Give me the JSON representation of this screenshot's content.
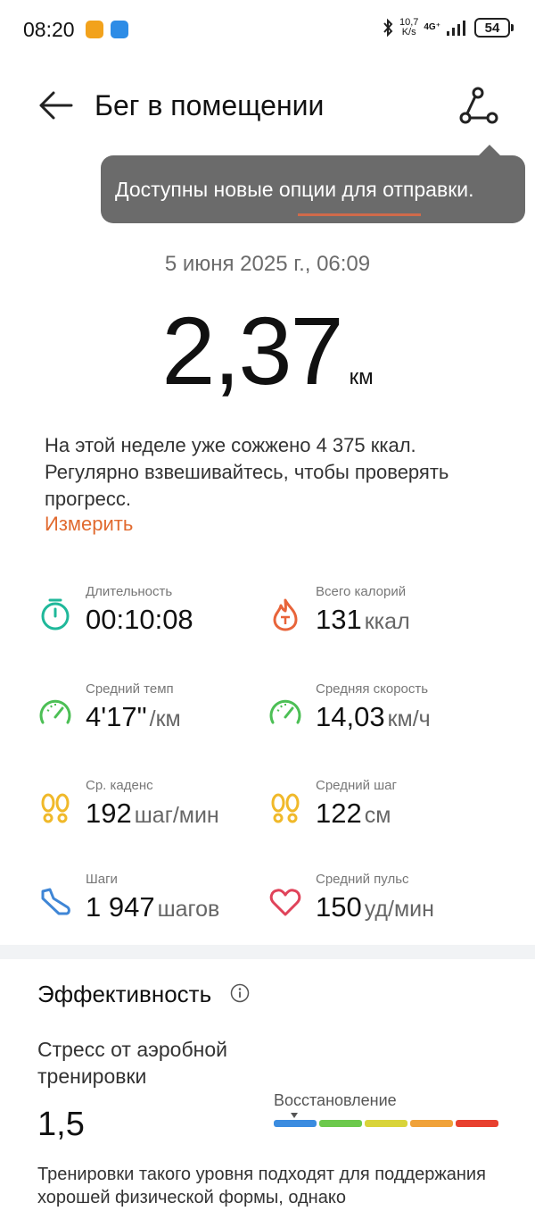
{
  "status_bar": {
    "time": "08:20",
    "speed_top": "10,7",
    "speed_bottom": "K/s",
    "network": "4G⁺",
    "battery": "54"
  },
  "header": {
    "title": "Бег в помещении"
  },
  "tooltip": {
    "text": "Доступны новые опции для отправки."
  },
  "workout": {
    "date": "5 июня 2025 г., 06:09",
    "distance": "2,37",
    "distance_unit": "км"
  },
  "message": {
    "text": "На этой неделе уже сожжено 4 375 ккал. Регулярно взвешивайтесь, чтобы проверять прогресс.",
    "link": "Измерить"
  },
  "metrics": [
    {
      "label": "Длительность",
      "value": "00:10:08",
      "unit": "",
      "icon": "stopwatch-icon",
      "color": "#1fb89a"
    },
    {
      "label": "Всего калорий",
      "value": "131",
      "unit": "ккал",
      "icon": "flame-icon",
      "color": "#e8643a"
    },
    {
      "label": "Средний темп",
      "value": "4'17\"",
      "unit": "/км",
      "icon": "speedometer-icon",
      "color": "#4cbf55"
    },
    {
      "label": "Средняя скорость",
      "value": "14,03",
      "unit": "км/ч",
      "icon": "speedometer-icon",
      "color": "#4cbf55"
    },
    {
      "label": "Ср. каденс",
      "value": "192",
      "unit": "шаг/мин",
      "icon": "footprints-icon",
      "color": "#f0b92a"
    },
    {
      "label": "Средний шаг",
      "value": "122",
      "unit": "см",
      "icon": "footprints-icon",
      "color": "#f0b92a"
    },
    {
      "label": "Шаги",
      "value": "1 947",
      "unit": "шагов",
      "icon": "shoe-icon",
      "color": "#3f86d6"
    },
    {
      "label": "Средний пульс",
      "value": "150",
      "unit": "уд/мин",
      "icon": "heart-icon",
      "color": "#e0435a"
    }
  ],
  "efficiency": {
    "title": "Эффективность",
    "stress_label": "Стресс от аэробной тренировки",
    "stress_value": "1,5",
    "level_label": "Восстановление",
    "level_colors": [
      "#3b8ce0",
      "#6cc94c",
      "#d9d43a",
      "#f0a23a",
      "#e8402f"
    ],
    "description": "Тренировки такого уровня подходят для поддержания хорошей физической формы, однако"
  }
}
